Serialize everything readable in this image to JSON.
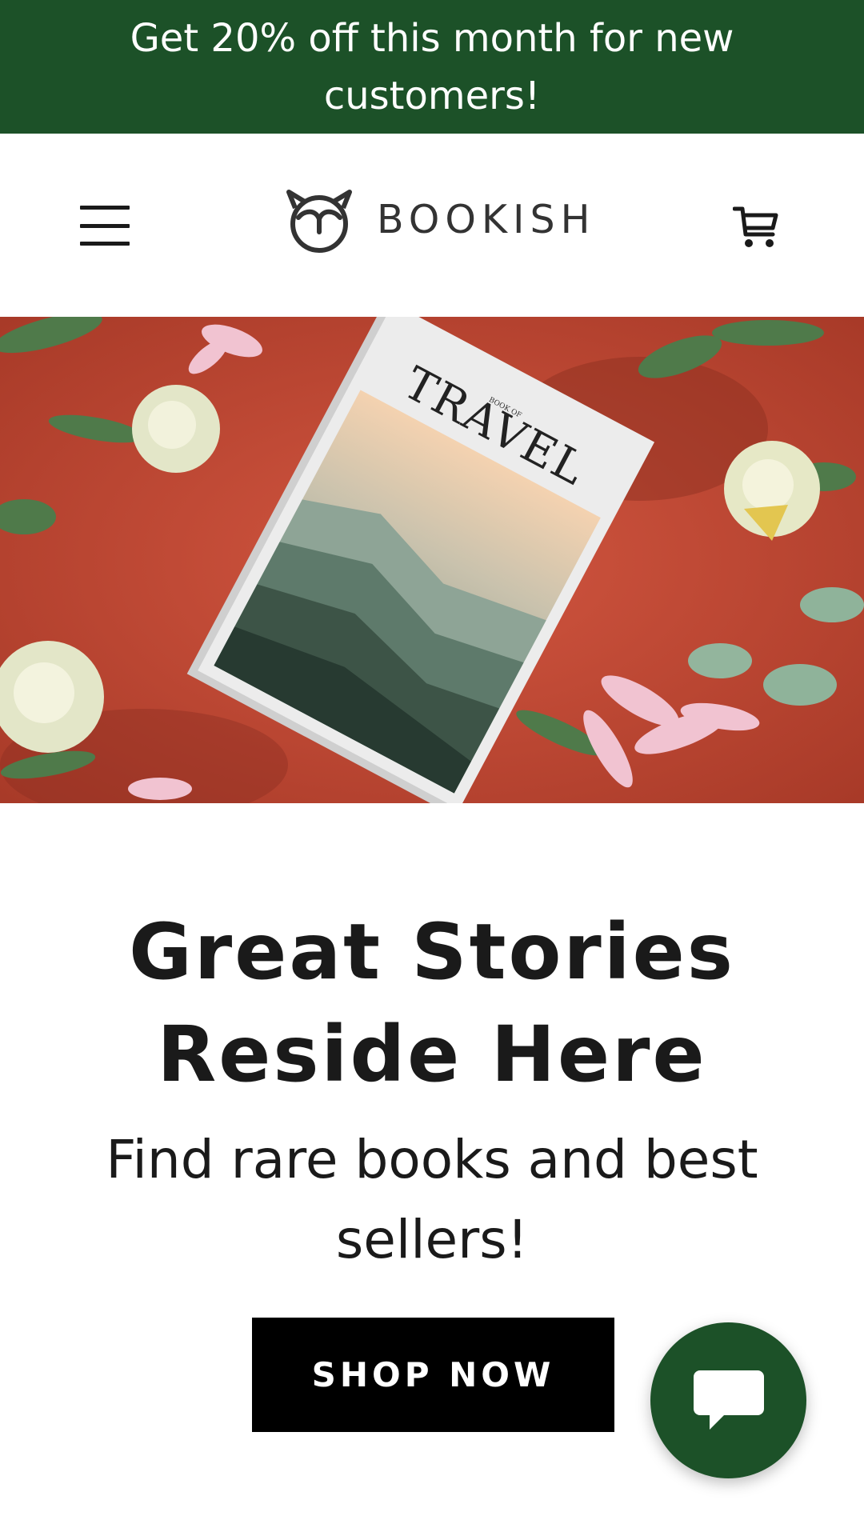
{
  "promo": {
    "text": "Get 20% off this month for new customers!"
  },
  "header": {
    "menu_icon": "hamburger-menu-icon",
    "logo_icon": "owl-icon",
    "logo_text": "BOOKISH",
    "cart_icon": "shopping-cart-icon"
  },
  "hero": {
    "image": "travel-book-with-flowers-photo",
    "book_small_text": "BOOK OF",
    "book_title": "TRAVEL"
  },
  "main": {
    "headline": "Great Stories Reside Here",
    "subheadline": "Find rare books and best sellers!",
    "cta_label": "SHOP NOW"
  },
  "chat": {
    "icon": "chat-bubble-icon"
  },
  "colors": {
    "brand_green": "#1c5128",
    "cta_background": "#000000",
    "hero_background": "#c84a35"
  }
}
